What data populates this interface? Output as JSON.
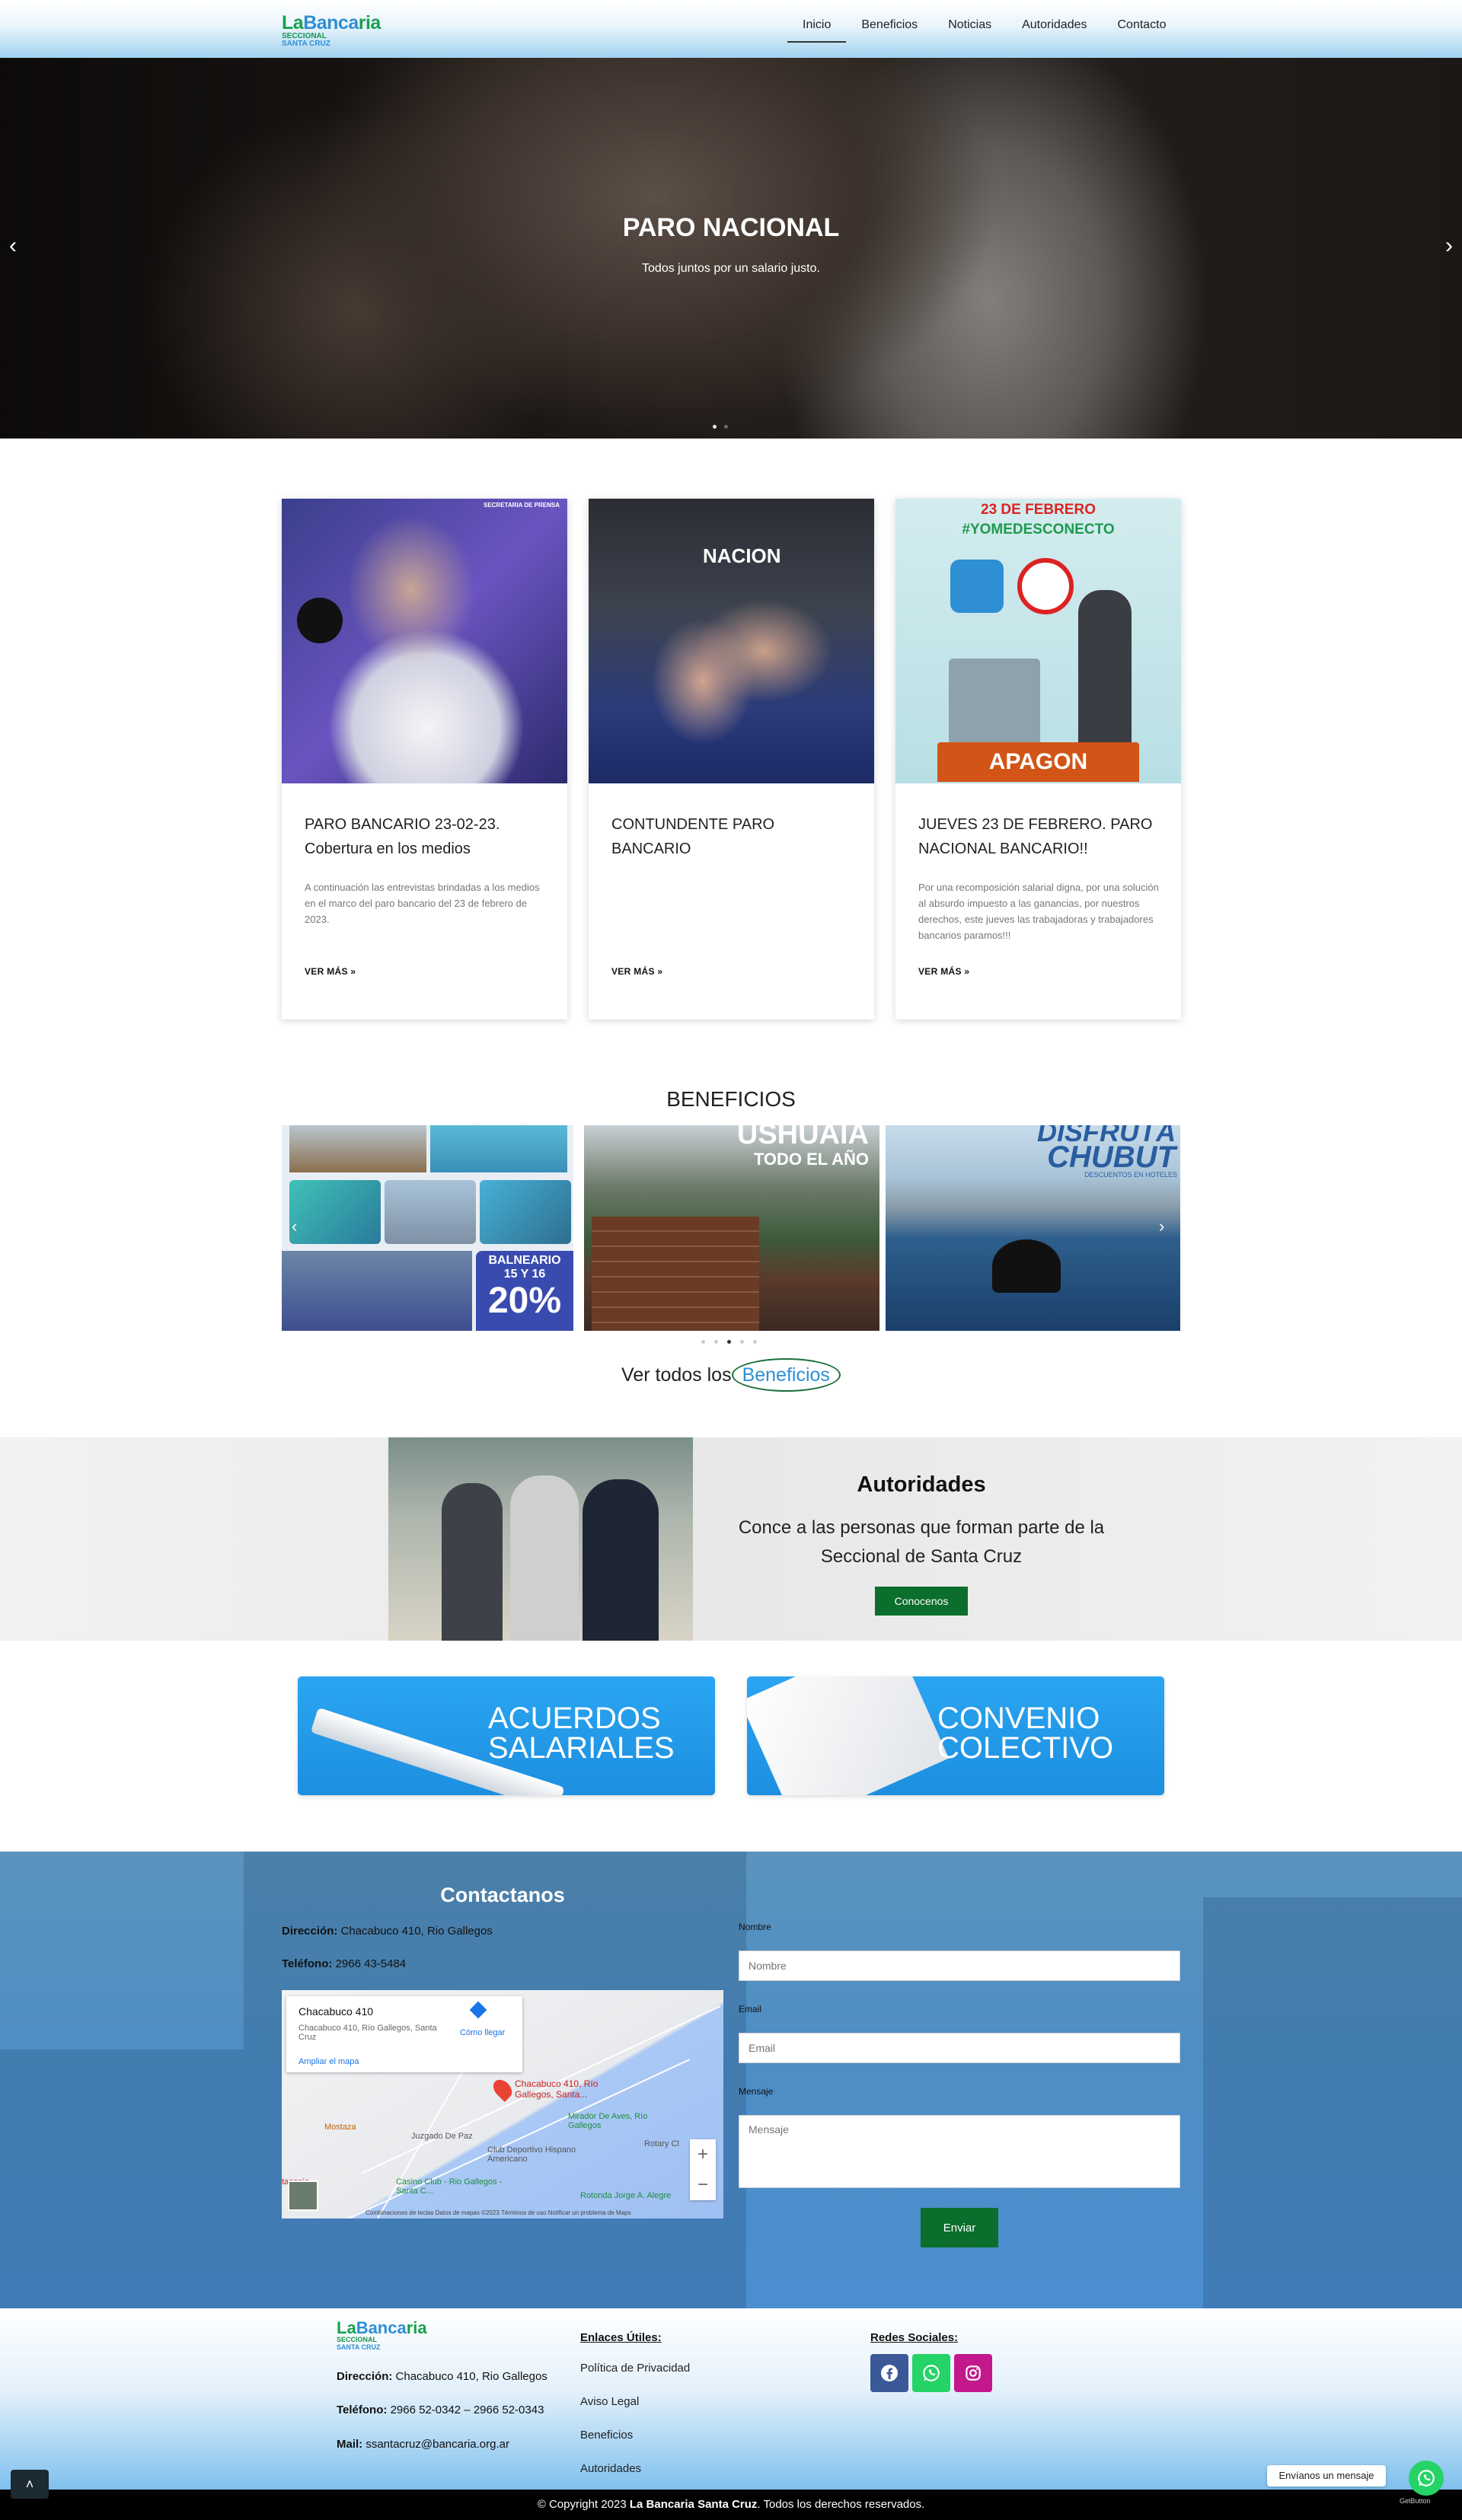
{
  "header": {
    "logo": {
      "line1a": "La",
      "line1b": "Banca",
      "line1c": "ria",
      "line2": "SECCIONAL",
      "line3": "SANTA CRUZ"
    },
    "nav": [
      {
        "label": "Inicio",
        "active": true
      },
      {
        "label": "Beneficios"
      },
      {
        "label": "Noticias"
      },
      {
        "label": "Autoridades"
      },
      {
        "label": "Contacto"
      }
    ]
  },
  "hero": {
    "title": "PARO NACIONAL",
    "subtitle": "Todos juntos por un salario justo.",
    "prev_icon": "chevron-left-icon",
    "next_icon": "chevron-right-icon"
  },
  "posts": [
    {
      "title": "PARO BANCARIO 23-02-23. Cobertura en los medios",
      "excerpt": "A continuación las entrevistas brindadas a los medios en el marco del paro bancario del 23 de febrero de 2023.",
      "more": "VER MÁS »",
      "image_caption": "SECRETARIA DE PRENSA"
    },
    {
      "title": "CONTUNDENTE PARO BANCARIO",
      "excerpt": "",
      "more": "VER MÁS »",
      "image_caption": "NACION"
    },
    {
      "title": "JUEVES 23 DE FEBRERO. PARO NACIONAL BANCARIO!!",
      "excerpt": "Por una recomposición salarial digna, por una solución al absurdo impuesto a las ganancias, por nuestros derechos, este jueves las trabajadoras y trabajadores bancarios paramos!!!",
      "more": "VER MÁS »",
      "image_top": "23 DE FEBRERO",
      "image_tag": "#YOMEDESCONECTO",
      "image_bottom": "APAGON"
    }
  ],
  "beneficios": {
    "title": "BENEFICIOS",
    "slides": [
      {
        "line1": "BALNEARIO",
        "line2": "15 Y 16",
        "line3": "20%"
      },
      {
        "line1": "USHUAIA",
        "line2": "TODO EL AÑO"
      },
      {
        "line1": "DISFRUTÁ",
        "line2": "CHUBUT",
        "line3": "DESCUENTOS EN HOTELES"
      }
    ],
    "ver_prefix": "Ver todos los",
    "ver_link": "Beneficios"
  },
  "autoridades": {
    "title": "Autoridades",
    "text": "Conce a las personas que forman parte de la Seccional de Santa Cruz",
    "button": "Conocenos"
  },
  "links": {
    "acuerdos": "ACUERDOS SALARIALES",
    "convenio": "CONVENIO COLECTIVO"
  },
  "contact": {
    "title": "Contactanos",
    "direccion_label": "Dirección:",
    "direccion": "Chacabuco 410, Rio Gallegos",
    "telefono_label": "Teléfono:",
    "telefono": "2966 43-5484",
    "map": {
      "place": "Chacabuco 410",
      "address": "Chacabuco 410, Río Gallegos, Santa Cruz",
      "directions": "Cómo llegar",
      "enlarge": "Ampliar el mapa",
      "pin_label": "Chacabuco 410, Río Gallegos, Santa...",
      "poi": [
        "Mirador De Aves, Río Gallegos",
        "Mostaza",
        "Juzgado De Paz",
        "Club Deportivo Hispano Americano",
        "Rotary Cl",
        "Casino Club - Rio Gallegos - Santa C...",
        "Rotonda Jorge A. Alegre",
        "tagonia"
      ],
      "footer": "Combinaciones de teclas   Datos de mapas ©2023   Términos de uso   Notificar un problema de Maps"
    },
    "form": {
      "name_label": "Nombre",
      "name_placeholder": "Nombre",
      "email_label": "Email",
      "email_placeholder": "Email",
      "message_label": "Mensaje",
      "message_placeholder": "Mensaje",
      "submit": "Enviar"
    }
  },
  "footer": {
    "direccion_label": "Dirección:",
    "direccion": "Chacabuco 410, Rio Gallegos",
    "telefono_label": "Teléfono:",
    "telefono": "2966 52-0342 – 2966 52-0343",
    "mail_label": "Mail:",
    "mail": "ssantacruz@bancaria.org.ar",
    "links_title": "Enlaces Útiles:",
    "links": [
      "Política de Privacidad",
      "Aviso Legal",
      "Beneficios",
      "Autoridades"
    ],
    "social_title": "Redes Sociales:",
    "social": [
      {
        "icon": "facebook-icon",
        "color": "#3b5998"
      },
      {
        "icon": "whatsapp-icon",
        "color": "#25d366"
      },
      {
        "icon": "instagram-icon",
        "color": "#c2188b"
      }
    ],
    "copyright_pre": "© Copyright 2023",
    "copyright_brand": "La Bancaria Santa Cruz",
    "copyright_post": ". Todos los derechos reservados.",
    "whatsapp_msg": "Envíanos un mensaje",
    "getbutton": "GetButton"
  },
  "colors": {
    "brand_green": "#0c6e2c",
    "brand_blue": "#2e8fd4",
    "header_gradient_end": "#9fd2f0"
  }
}
